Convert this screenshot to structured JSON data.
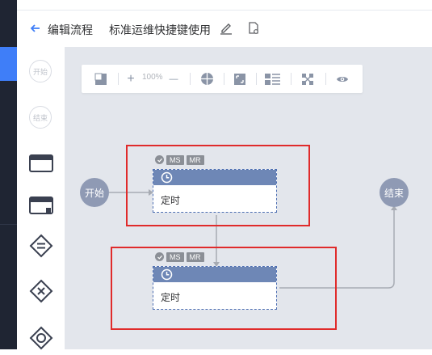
{
  "header": {
    "back_label": "编辑流程",
    "process_name": "标准运维快捷键使用"
  },
  "palette": {
    "start_label": "开始",
    "end_label": "结束"
  },
  "toolbar": {
    "zoom_plus": "+",
    "zoom_percent": "100%",
    "zoom_minus": "—"
  },
  "flow": {
    "start_node": "开始",
    "end_node": "结束",
    "tasks": [
      {
        "label": "定时",
        "badges": [
          "MS",
          "MR"
        ]
      },
      {
        "label": "定时",
        "badges": [
          "MS",
          "MR"
        ]
      }
    ]
  },
  "colors": {
    "accent": "#3f7ef8",
    "node": "#8f9ab4",
    "task_bar": "#6e87b6",
    "highlight": "#e02b2b",
    "canvas": "#e3e6ec"
  }
}
